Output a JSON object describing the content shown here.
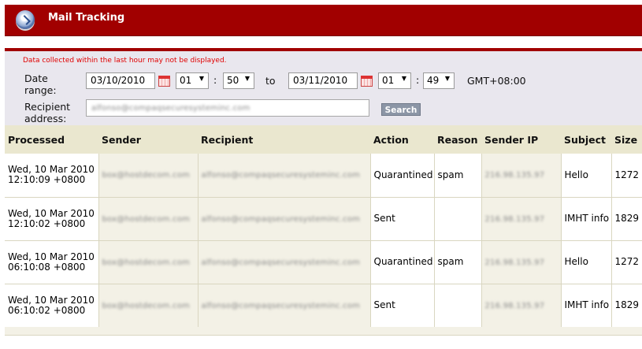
{
  "header": {
    "title": "Mail Tracking",
    "logo_icon": "mail-tracking-logo-icon",
    "color": "#a10000"
  },
  "filter": {
    "notice": "Data collected within the last hour may not be displayed.",
    "date_label": "Date range:",
    "from_date": "03/10/2010",
    "from_hour": "01",
    "from_minute": "50",
    "to_label": "to",
    "to_date": "03/11/2010",
    "to_hour": "01",
    "to_minute": "49",
    "timezone": "GMT+08:00",
    "recipient_label": "Recipient address:",
    "recipient_value": "alfonso@compaqsecuresysteminc.com",
    "search_label": "Search"
  },
  "table": {
    "headers": [
      "Processed",
      "Sender",
      "Recipient",
      "Action",
      "Reason",
      "Sender IP",
      "Subject",
      "Size"
    ],
    "rows": [
      {
        "processed": "Wed, 10 Mar 2010 12:10:09 +0800",
        "sender": "box@hostdecom.com",
        "recipient": "alfonso@compaqsecuresysteminc.com",
        "action": "Quarantined",
        "reason": "spam",
        "sender_ip": "216.98.135.97",
        "subject": "Hello",
        "size": "1272"
      },
      {
        "processed": "Wed, 10 Mar 2010 12:10:02 +0800",
        "sender": "box@hostdecom.com",
        "recipient": "alfonso@compaqsecuresysteminc.com",
        "action": "Sent",
        "reason": "",
        "sender_ip": "216.98.135.97",
        "subject": "IMHT info",
        "size": "1829"
      },
      {
        "processed": "Wed, 10 Mar 2010 06:10:08 +0800",
        "sender": "box@hostdecom.com",
        "recipient": "alfonso@compaqsecuresysteminc.com",
        "action": "Quarantined",
        "reason": "spam",
        "sender_ip": "216.98.135.97",
        "subject": "Hello",
        "size": "1272"
      },
      {
        "processed": "Wed, 10 Mar 2010 06:10:02 +0800",
        "sender": "box@hostdecom.com",
        "recipient": "alfonso@compaqsecuresysteminc.com",
        "action": "Sent",
        "reason": "",
        "sender_ip": "216.98.135.97",
        "subject": "IMHT info",
        "size": "1829"
      }
    ]
  },
  "colors": {
    "header_red": "#a10000",
    "notice_red": "#e00000",
    "filter_bg": "#e9e7ee",
    "table_header_bg": "#eae7cf"
  }
}
